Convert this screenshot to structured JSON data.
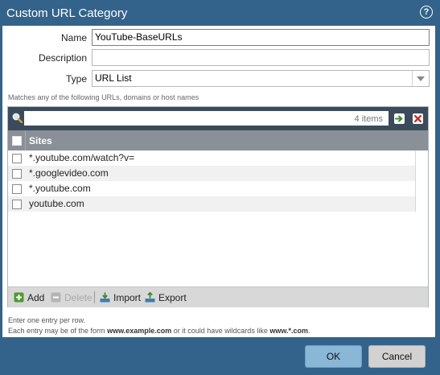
{
  "dialog": {
    "title": "Custom URL Category",
    "help_icon": "question-circle-icon",
    "help_glyph": "?"
  },
  "form": {
    "name_label": "Name",
    "name_value": "YouTube-BaseURLs",
    "description_label": "Description",
    "description_value": "",
    "type_label": "Type",
    "type_value": "URL List"
  },
  "list": {
    "hint_top": "Matches any of the following URLs, domains or host names",
    "search_placeholder": "",
    "item_count": "4 items",
    "column_sites": "Sites",
    "rows": [
      {
        "site": "*.youtube.com/watch?v="
      },
      {
        "site": "*.googlevideo.com"
      },
      {
        "site": "*.youtube.com"
      },
      {
        "site": "youtube.com"
      }
    ]
  },
  "toolbar": {
    "add_label": "Add",
    "delete_label": "Delete",
    "import_label": "Import",
    "export_label": "Export"
  },
  "hints": {
    "line1": "Enter one entry per row.",
    "line2_prefix": "Each entry may be of the form ",
    "line2_example1": "www.example.com",
    "line2_middle": " or it could have wildcards like ",
    "line2_example2": "www.*.com",
    "line2_suffix": "."
  },
  "footer": {
    "ok_label": "OK",
    "cancel_label": "Cancel"
  },
  "colors": {
    "title_bar": "#33638a",
    "table_header": "#8a9098",
    "search_bar": "#3b4b5b",
    "ok_button": "#8ab7d6"
  }
}
